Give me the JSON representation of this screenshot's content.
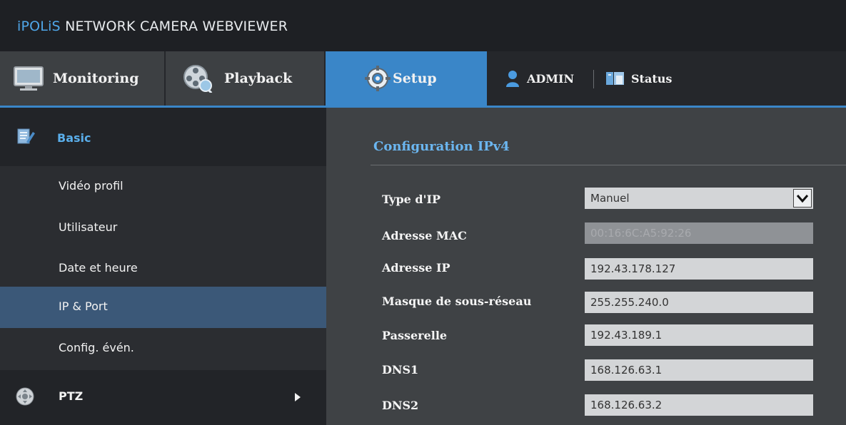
{
  "app": {
    "brand_prefix": "iPOLiS",
    "title": "NETWORK CAMERA WEBVIEWER"
  },
  "nav": {
    "monitoring": "Monitoring",
    "playback": "Playback",
    "setup": "Setup",
    "admin": "ADMIN",
    "status": "Status"
  },
  "sidebar": {
    "section": "Basic",
    "items": [
      {
        "label": "Vidéo profil",
        "active": false
      },
      {
        "label": "Utilisateur",
        "active": false
      },
      {
        "label": "Date et heure",
        "active": false
      },
      {
        "label": "IP & Port",
        "active": true
      },
      {
        "label": "Config. évén."
      }
    ],
    "ptz": "PTZ"
  },
  "main": {
    "title": "Configuration IPv4",
    "fields": {
      "ip_type": {
        "label": "Type d'IP",
        "value": "Manuel"
      },
      "mac": {
        "label": "Adresse MAC",
        "value": "00:16:6C:A5:92:26"
      },
      "ip": {
        "label": "Adresse IP",
        "value": "192.43.178.127"
      },
      "mask": {
        "label": "Masque de sous-réseau",
        "value": "255.255.240.0"
      },
      "gateway": {
        "label": "Passerelle",
        "value": "192.43.189.1"
      },
      "dns1": {
        "label": "DNS1",
        "value": "168.126.63.1"
      },
      "dns2": {
        "label": "DNS2",
        "value": "168.126.63.2"
      }
    }
  },
  "colors": {
    "accent": "#3a86c8",
    "section_title": "#6bb6f0",
    "active_item": "#3b5878"
  }
}
